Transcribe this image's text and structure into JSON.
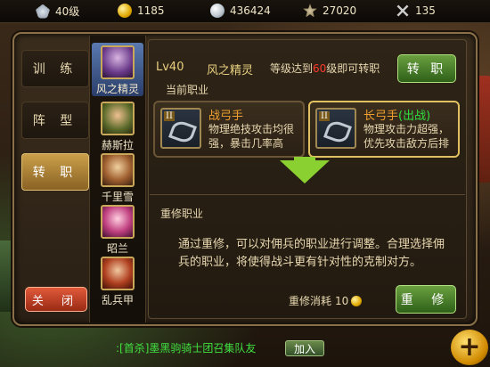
{
  "resources": [
    {
      "icon": "level-icon",
      "value": "40级"
    },
    {
      "icon": "gold-coin-icon",
      "value": "1185"
    },
    {
      "icon": "silver-coin-icon",
      "value": "436424"
    },
    {
      "icon": "honor-icon",
      "value": "27020"
    },
    {
      "icon": "swords-icon",
      "value": "135"
    }
  ],
  "menu": {
    "items": [
      {
        "label": "训 练"
      },
      {
        "label": "阵 型"
      },
      {
        "label": "转 职"
      }
    ],
    "active_index": 2,
    "close_label": "关 闭"
  },
  "heroes": [
    {
      "name": "风之精灵",
      "selected": true
    },
    {
      "name": "赫斯拉"
    },
    {
      "name": "千里雪"
    },
    {
      "name": "昭兰"
    },
    {
      "name": "乱兵甲"
    }
  ],
  "detail": {
    "level": "Lv40",
    "hero_name": "风之精灵",
    "requirement_prefix": "等级达到",
    "requirement_level": "60",
    "requirement_suffix": "级即可转职",
    "transfer_button": "转 职",
    "current_section": "当前职业",
    "jobs": [
      {
        "rank": "II",
        "title": "战弓手",
        "tag": "",
        "desc": "物理绝技攻击均很强，暴击几率高"
      },
      {
        "rank": "II",
        "title": "长弓手",
        "tag": "(出战)",
        "desc": "物理攻击力超强，优先攻击敌方后排"
      }
    ],
    "rebuild_section": "重修职业",
    "rebuild_desc": "通过重修，可以对佣兵的职业进行调整。合理选择佣兵的职业，将使得战斗更有针对性的克制对方。",
    "cost_label": "重修消耗",
    "cost_value": "10",
    "rebuild_button": "重 修"
  },
  "chat": {
    "text": ":[首杀]墨黑驹骑士团召集队友",
    "join_label": "加入"
  },
  "colors": {
    "highlight_red": "#ff3a2a",
    "green_button": "#4a8a2a",
    "close_red": "#c0402a",
    "chat_green": "#40e040"
  }
}
